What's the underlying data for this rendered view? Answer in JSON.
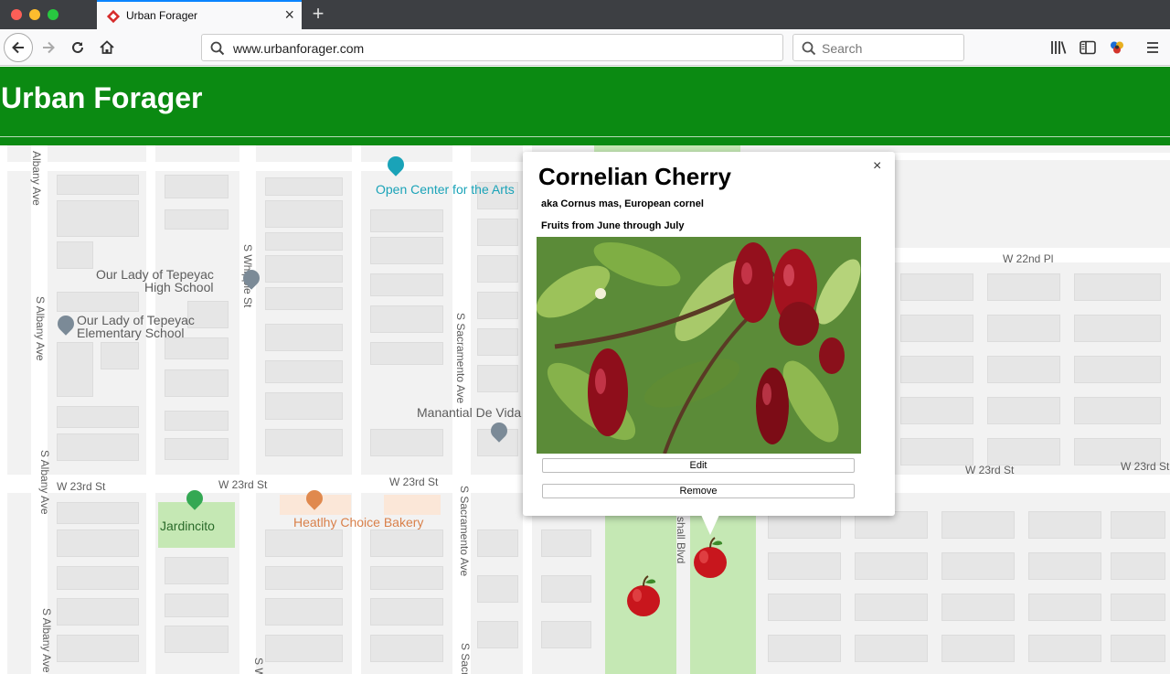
{
  "browser": {
    "tab_title": "Urban Forager",
    "url": "www.urbanforager.com",
    "search_placeholder": "Search"
  },
  "header": {
    "title": "Urban Forager"
  },
  "map": {
    "streets": {
      "albany_ave_top": "Albany Ave",
      "s_albany_ave_1": "S Albany Ave",
      "s_albany_ave_2": "S Albany Ave",
      "s_albany_ave_3": "S Albany Ave",
      "s_whipple_st": "S Whipple St",
      "s_sacramento_ave_1": "S Sacramento Ave",
      "s_sacramento_ave_2": "S Sacramento Ave",
      "s_sacramento_ave_3": "S Sacr",
      "s_w_bottom": "S W",
      "w_23rd_st_1": "W 23rd St",
      "w_23rd_st_2": "W 23rd St",
      "w_23rd_st_3": "W 23rd St",
      "w_23rd_st_4": "W 23rd St",
      "w_23rd_st_5": "W 23rd St",
      "w_22nd_pl": "W 22nd Pl",
      "marshall_blvd": "shall Blvd"
    },
    "pois": {
      "open_center": "Open Center for the Arts",
      "olt_high_school_1": "Our Lady of Tepeyac",
      "olt_high_school_2": "High School",
      "olt_elem_school_1": "Our Lady of Tepeyac",
      "olt_elem_school_2": "Elementary School",
      "manantial": "Manantial De Vida",
      "jardincito": "Jardincito",
      "bakery": "Heatlhy Choice Bakery"
    }
  },
  "popup": {
    "name": "Cornelian Cherry",
    "aka": "aka Cornus mas, European cornel",
    "season": "Fruits from June through July",
    "close_label": "×",
    "edit_label": "Edit",
    "remove_label": "Remove"
  },
  "colors": {
    "header_green": "#0b8a12",
    "park_green": "#c5e8b4",
    "poi_teal": "#1aa3b8",
    "poi_orange": "#e0894e",
    "poi_gray": "#7b8a97"
  }
}
